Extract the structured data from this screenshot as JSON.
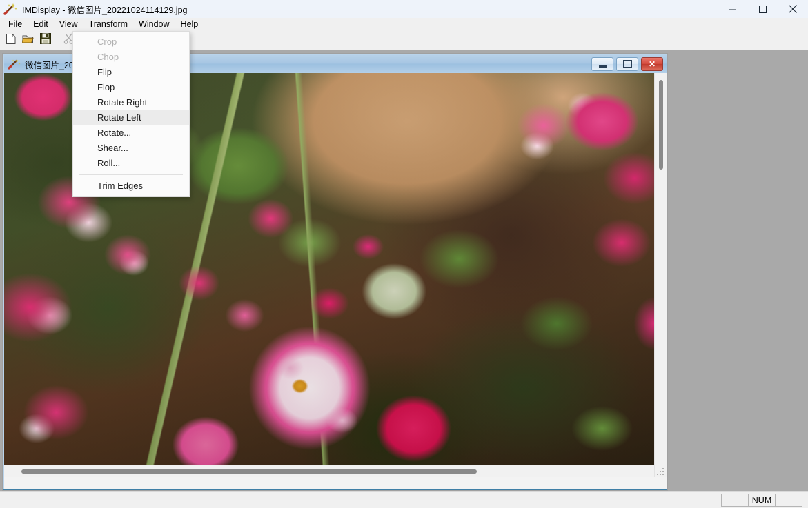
{
  "window": {
    "title": "IMDisplay - 微信图片_20221024114129.jpg",
    "icon": "imagemagick-wand-icon",
    "controls": {
      "minimize": "minimize-icon",
      "maximize": "maximize-icon",
      "close": "close-icon"
    }
  },
  "menubar": {
    "items": [
      {
        "label": "File",
        "active": false
      },
      {
        "label": "Edit",
        "active": false
      },
      {
        "label": "View",
        "active": false
      },
      {
        "label": "Transform",
        "active": true
      },
      {
        "label": "Window",
        "active": false
      },
      {
        "label": "Help",
        "active": false
      }
    ]
  },
  "toolbar": {
    "buttons": [
      {
        "name": "new-file-icon",
        "enabled": true
      },
      {
        "name": "open-folder-icon",
        "enabled": true
      },
      {
        "name": "save-floppy-icon",
        "enabled": true
      },
      {
        "name": "cut-scissors-icon",
        "enabled": false
      }
    ]
  },
  "dropdown": {
    "owner": "Transform",
    "items": [
      {
        "label": "Crop",
        "disabled": true,
        "hover": false
      },
      {
        "label": "Chop",
        "disabled": true,
        "hover": false
      },
      {
        "label": "Flip",
        "disabled": false,
        "hover": false
      },
      {
        "label": "Flop",
        "disabled": false,
        "hover": false
      },
      {
        "label": "Rotate Right",
        "disabled": false,
        "hover": false
      },
      {
        "label": "Rotate Left",
        "disabled": false,
        "hover": true
      },
      {
        "label": "Rotate...",
        "disabled": false,
        "hover": false
      },
      {
        "label": "Shear...",
        "disabled": false,
        "hover": false
      },
      {
        "label": "Roll...",
        "disabled": false,
        "hover": false
      },
      {
        "label": "Trim Edges",
        "disabled": false,
        "hover": false,
        "after_separator": true
      }
    ]
  },
  "child_window": {
    "title": "微信图片_20221024114129.jpg",
    "icon": "imagemagick-wand-icon",
    "controls": {
      "minimize": "minimize-icon",
      "restore": "restore-icon",
      "close": "close-icon"
    },
    "image": {
      "name": "pink-roses-photograph",
      "description": "Close-up photograph of pink and white roses with green leaves over tan soil"
    }
  },
  "statusbar": {
    "panes": [
      "",
      "NUM",
      ""
    ]
  },
  "colors": {
    "titlebar_bg": "#eef3fa",
    "menubar_bg": "#f0f0f0",
    "mdi_bg": "#a9a9a9",
    "child_title_bg": "#a7c6e3",
    "child_border": "#3f7fa6",
    "menu_bg": "#fbfbfb",
    "menu_hover": "#ebebeb",
    "menu_disabled_text": "#b0b0b0",
    "close_button_red": "#c13a2d",
    "scrollbar_thumb": "#8a8a8a"
  }
}
